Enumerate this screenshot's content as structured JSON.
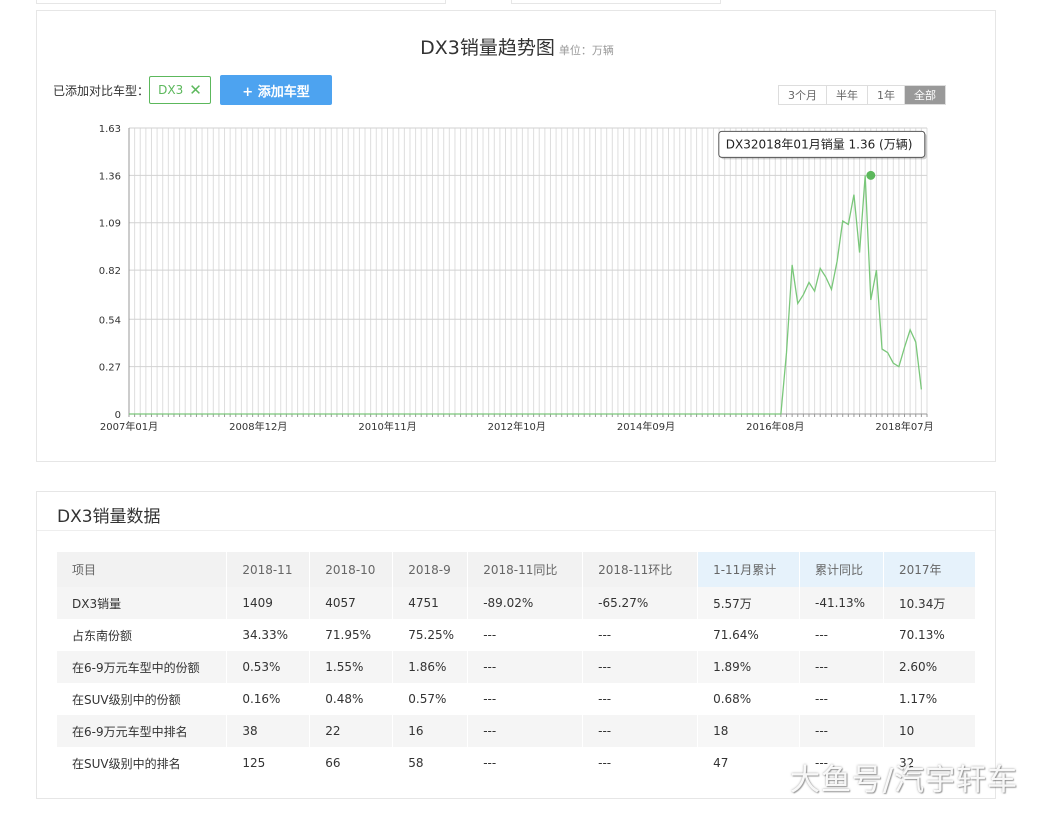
{
  "header": {
    "title": "DX3销量趋势图",
    "unit": "单位：万辆"
  },
  "compare": {
    "label": "已添加对比车型：",
    "tag": "DX3",
    "add_button": "+ 添加车型"
  },
  "ranges": [
    "3个月",
    "半年",
    "1年",
    "全部"
  ],
  "active_range": "全部",
  "chart_data": {
    "type": "line",
    "series": [
      {
        "name": "DX3",
        "color": "#7ac77a"
      }
    ],
    "x_ticks": [
      "2007年01月",
      "2008年12月",
      "2010年11月",
      "2012年10月",
      "2014年09月",
      "2016年08月",
      "2018年07月"
    ],
    "y_ticks": [
      "0",
      "0.27",
      "0.54",
      "0.82",
      "1.09",
      "1.36",
      "1.63"
    ],
    "ylim": [
      0,
      1.63
    ],
    "start": "2007-01",
    "end": "2018-11",
    "zero_until": "2016-09",
    "values_from_2016_10": [
      0.35,
      0.85,
      0.63,
      0.68,
      0.75,
      0.7,
      0.83,
      0.78,
      0.71,
      0.87,
      1.1,
      1.08,
      1.25,
      0.92,
      1.36,
      0.65,
      0.82,
      0.37,
      0.35,
      0.29,
      0.27,
      0.38,
      0.48,
      0.41,
      0.14
    ],
    "tooltip": {
      "text": "DX32018年01月销量 1.36 (万辆)",
      "x": "2018-01",
      "y": 1.36
    },
    "grid": true
  },
  "table": {
    "title": "DX3销量数据",
    "headers": [
      "项目",
      "2018-11",
      "2018-10",
      "2018-9",
      "2018-11同比",
      "2018-11环比",
      "1-11月累计",
      "累计同比",
      "2017年"
    ],
    "rows": [
      [
        "DX3销量",
        "1409",
        "4057",
        "4751",
        "-89.02%",
        "-65.27%",
        "5.57万",
        "-41.13%",
        "10.34万"
      ],
      [
        "占东南份额",
        "34.33%",
        "71.95%",
        "75.25%",
        "---",
        "---",
        "71.64%",
        "---",
        "70.13%"
      ],
      [
        "在6-9万元车型中的份额",
        "0.53%",
        "1.55%",
        "1.86%",
        "---",
        "---",
        "1.89%",
        "---",
        "2.60%"
      ],
      [
        "在SUV级别中的份额",
        "0.16%",
        "0.48%",
        "0.57%",
        "---",
        "---",
        "0.68%",
        "---",
        "1.17%"
      ],
      [
        "在6-9万元车型中排名",
        "38",
        "22",
        "16",
        "---",
        "---",
        "18",
        "---",
        "10"
      ],
      [
        "在SUV级别中的排名",
        "125",
        "66",
        "58",
        "---",
        "---",
        "47",
        "---",
        "32"
      ]
    ]
  },
  "watermark": "大鱼号/汽宇轩车"
}
